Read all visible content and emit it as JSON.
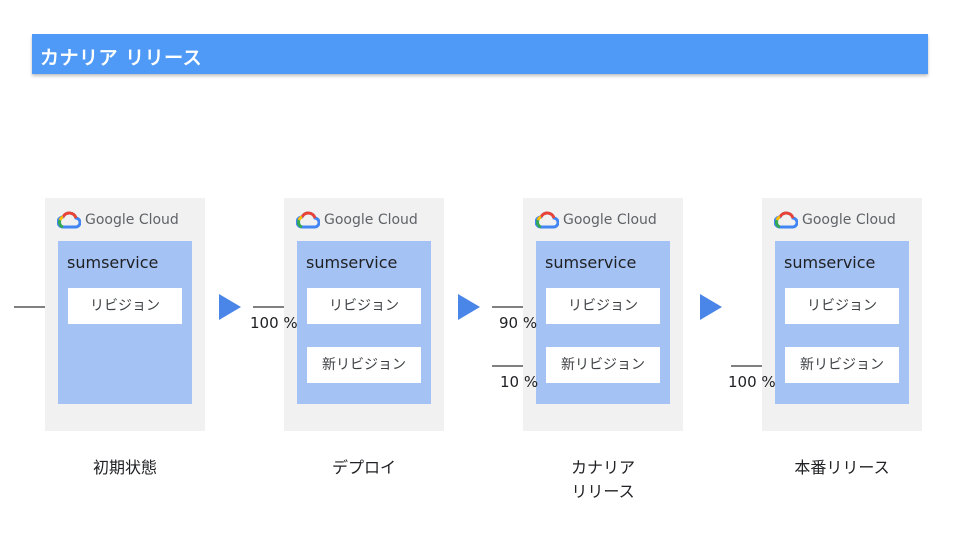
{
  "title": "カナリア リリース",
  "brand": "Google Cloud",
  "service_name": "sumservice",
  "revision_label": "リビジョン",
  "new_revision_label": "新リビジョン",
  "traffic": {
    "deploy": "100 %",
    "canary_old": "90 %",
    "canary_new": "10 %",
    "prod": "100 %"
  },
  "steps": [
    "初期状態",
    "デプロイ",
    "カナリア\nリリース",
    "本番リリース"
  ],
  "colors": {
    "title_bar": "#4f9af7",
    "panel": "#f1f1f1",
    "service_box": "#a4c2f4",
    "step_arrow": "#4a86e8"
  }
}
